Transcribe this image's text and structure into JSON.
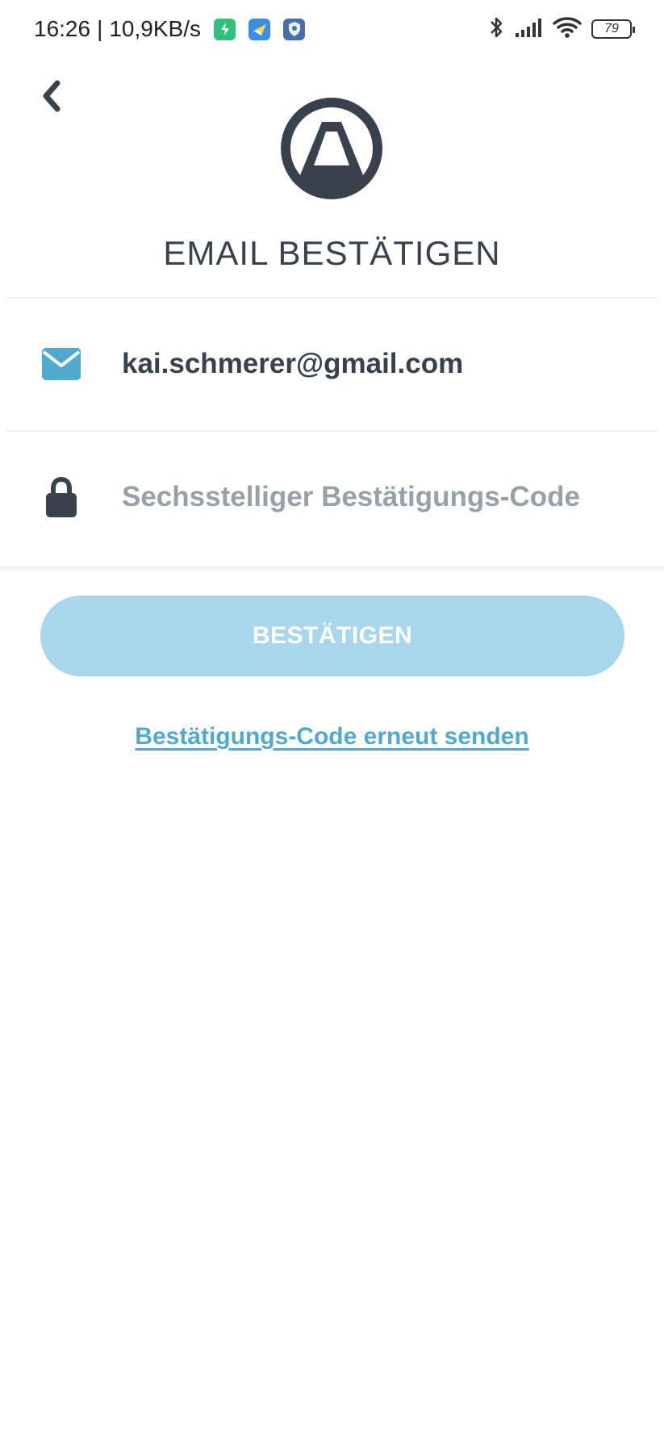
{
  "status_bar": {
    "time": "16:26",
    "separator": "|",
    "network_speed": "10,9KB/s",
    "battery_level": "79",
    "icons": [
      "green-app-icon",
      "paper-plane-app-icon",
      "shield-app-icon",
      "bluetooth-icon",
      "signal-icon",
      "wifi-icon",
      "battery-icon"
    ]
  },
  "header": {
    "back_icon": "chevron-left-icon",
    "logo_icon": "brand-logo-icon",
    "title": "EMAIL BESTÄTIGEN"
  },
  "form": {
    "email": {
      "icon": "envelope-icon",
      "value": "kai.schmerer@gmail.com"
    },
    "code": {
      "icon": "lock-icon",
      "value": "",
      "placeholder": "Sechsstelliger Bestätigungs-Code"
    }
  },
  "actions": {
    "confirm_label": "BESTÄTIGEN",
    "resend_label": "Bestätigungs-Code erneut senden"
  },
  "colors": {
    "text_dark": "#37424c",
    "accent_blue": "#51a9cf",
    "button_disabled": "#a8d6eb",
    "placeholder": "#97a2a8"
  }
}
